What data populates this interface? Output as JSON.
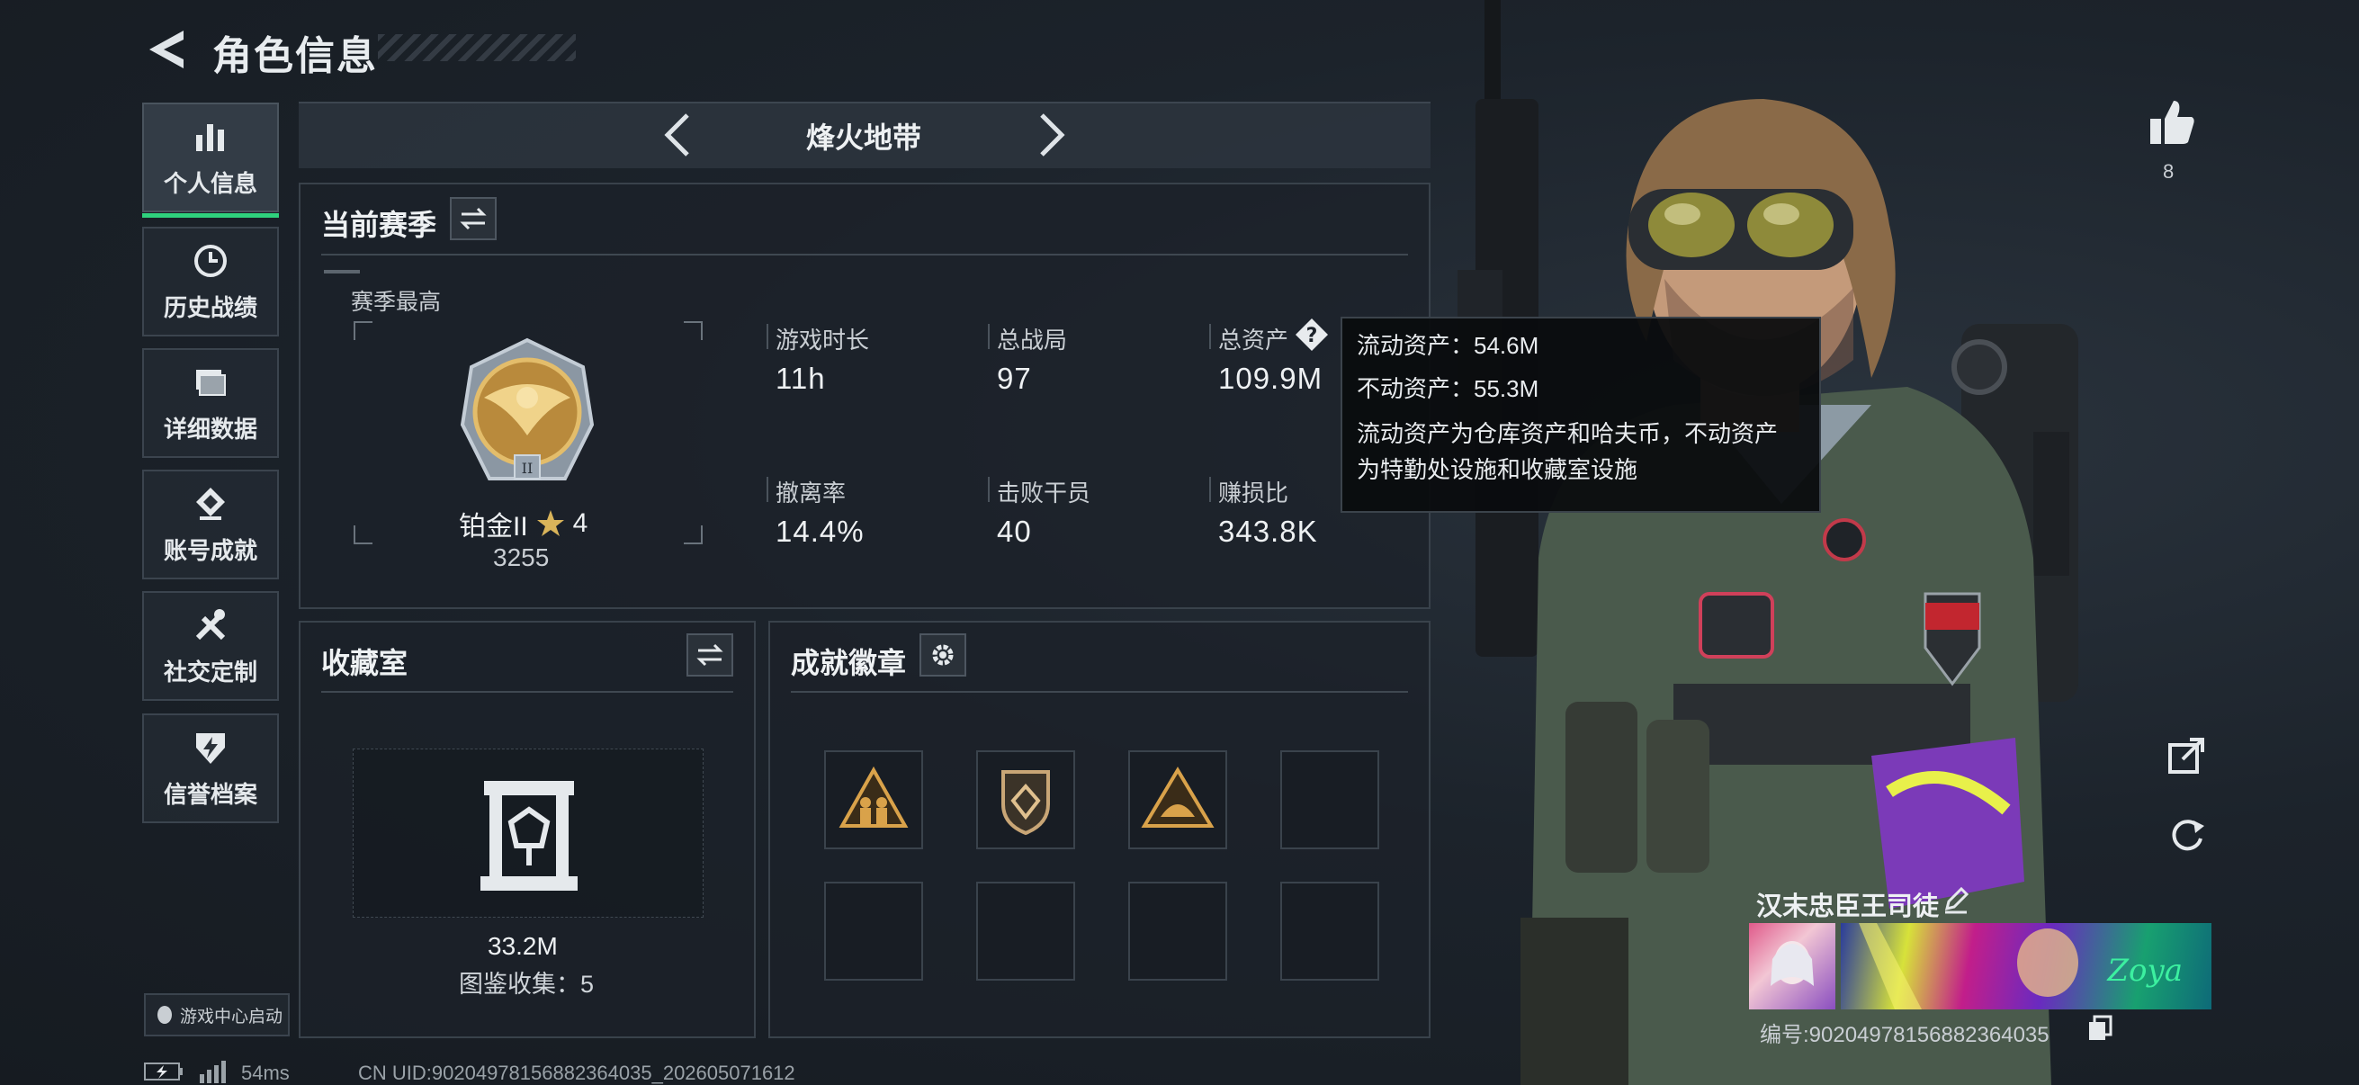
{
  "header": {
    "title": "角色信息"
  },
  "sidebar": {
    "items": [
      {
        "label": "个人信息",
        "icon": "bar-chart-icon",
        "active": true
      },
      {
        "label": "历史战绩",
        "icon": "history-icon"
      },
      {
        "label": "详细数据",
        "icon": "folder-icon"
      },
      {
        "label": "账号成就",
        "icon": "achievement-icon"
      },
      {
        "label": "社交定制",
        "icon": "tools-icon"
      },
      {
        "label": "信誉档案",
        "icon": "shield-bolt-icon"
      }
    ],
    "game_center": "游戏中心启动"
  },
  "mode": {
    "label": "烽火地带"
  },
  "season": {
    "title": "当前赛季",
    "best_label": "赛季最高",
    "rank_name": "铂金II",
    "rank_stars": "4",
    "rank_score": "3255",
    "stats": [
      {
        "label": "游戏时长",
        "value": "11h"
      },
      {
        "label": "总战局",
        "value": "97"
      },
      {
        "label": "总资产",
        "value": "109.9M"
      },
      {
        "label": "撤离率",
        "value": "14.4%"
      },
      {
        "label": "击败干员",
        "value": "40"
      },
      {
        "label": "赚损比",
        "value": "343.8K"
      }
    ]
  },
  "tooltip": {
    "line1": "流动资产：54.6M",
    "line2": "不动资产：55.3M",
    "line3": "流动资产为仓库资产和哈夫币，不动资产",
    "line4": "为特勤处设施和收藏室设施"
  },
  "collection": {
    "title": "收藏室",
    "value": "33.2M",
    "count_text": "图鉴收集：5"
  },
  "achievements": {
    "title": "成就徽章",
    "badges": [
      "badge-triangle-figures",
      "badge-shield-diamond",
      "badge-triangle-dome",
      "",
      "",
      "",
      "",
      ""
    ]
  },
  "profile": {
    "likes": "8",
    "player_name": "汉末忠臣王司徒",
    "player_id": "编号:90204978156882364035"
  },
  "status_bar": {
    "ping": "54ms",
    "uid": "CN UID:90204978156882364035_202605071612"
  },
  "colors": {
    "accent_green": "#2fd17d",
    "background": "#1b2129",
    "panel_border": "#39424b"
  }
}
